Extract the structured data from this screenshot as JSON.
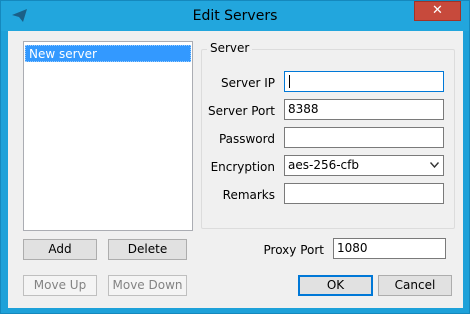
{
  "window": {
    "title": "Edit Servers",
    "close_glyph": "✕"
  },
  "servers": {
    "items": [
      "New server"
    ]
  },
  "buttons": {
    "add": "Add",
    "delete": "Delete",
    "move_up": "Move Up",
    "move_down": "Move Down",
    "ok": "OK",
    "cancel": "Cancel"
  },
  "server_group": {
    "legend": "Server",
    "server_ip_label": "Server IP",
    "server_ip_value": "",
    "server_port_label": "Server Port",
    "server_port_value": "8388",
    "password_label": "Password",
    "password_value": "",
    "encryption_label": "Encryption",
    "encryption_value": "aes-256-cfb",
    "remarks_label": "Remarks",
    "remarks_value": ""
  },
  "proxy": {
    "label": "Proxy Port",
    "value": "1080"
  },
  "colors": {
    "title_bar": "#22a6dd",
    "close_button": "#c74a3c",
    "selection": "#3399ff",
    "focus_border": "#0078d7"
  },
  "icons": {
    "app": "paper-plane-icon",
    "close": "close-icon",
    "dropdown": "chevron-down-icon"
  }
}
